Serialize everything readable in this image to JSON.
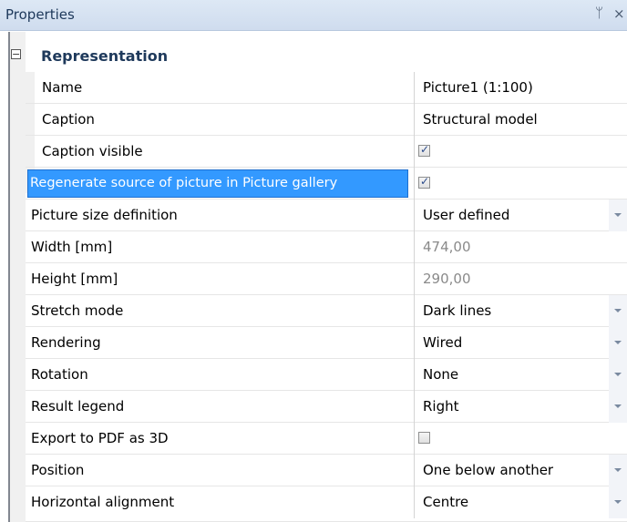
{
  "panel": {
    "title": "Properties",
    "pin_glyph": "ᛘ",
    "close_glyph": "×"
  },
  "category": {
    "label": "Representation",
    "toggle": "−"
  },
  "rows": [
    {
      "name": "Name",
      "value": "Picture1 (1:100)"
    },
    {
      "name": "Caption",
      "value": "Structural model"
    },
    {
      "name": "Caption visible",
      "value": "",
      "checkbox": true,
      "checked": true
    },
    {
      "name": "Regenerate source of picture in Picture gallery",
      "value": "",
      "checkbox": true,
      "checked": true,
      "selected": true
    },
    {
      "name": "Picture size definition",
      "value": "User defined",
      "dropdown": true
    },
    {
      "name": "Width [mm]",
      "value": "474,00",
      "disabled": true
    },
    {
      "name": "Height [mm]",
      "value": "290,00",
      "disabled": true
    },
    {
      "name": "Stretch mode",
      "value": "Dark lines",
      "dropdown": true
    },
    {
      "name": "Rendering",
      "value": "Wired",
      "dropdown": true
    },
    {
      "name": "Rotation",
      "value": "None",
      "dropdown": true
    },
    {
      "name": "Result legend",
      "value": "Right",
      "dropdown": true
    },
    {
      "name": "Export to PDF as 3D",
      "value": "",
      "checkbox": true,
      "checked": false
    },
    {
      "name": "Position",
      "value": "One below another",
      "dropdown": true
    },
    {
      "name": "Horizontal alignment",
      "value": "Centre",
      "dropdown": true
    }
  ],
  "checkmark": "✓"
}
